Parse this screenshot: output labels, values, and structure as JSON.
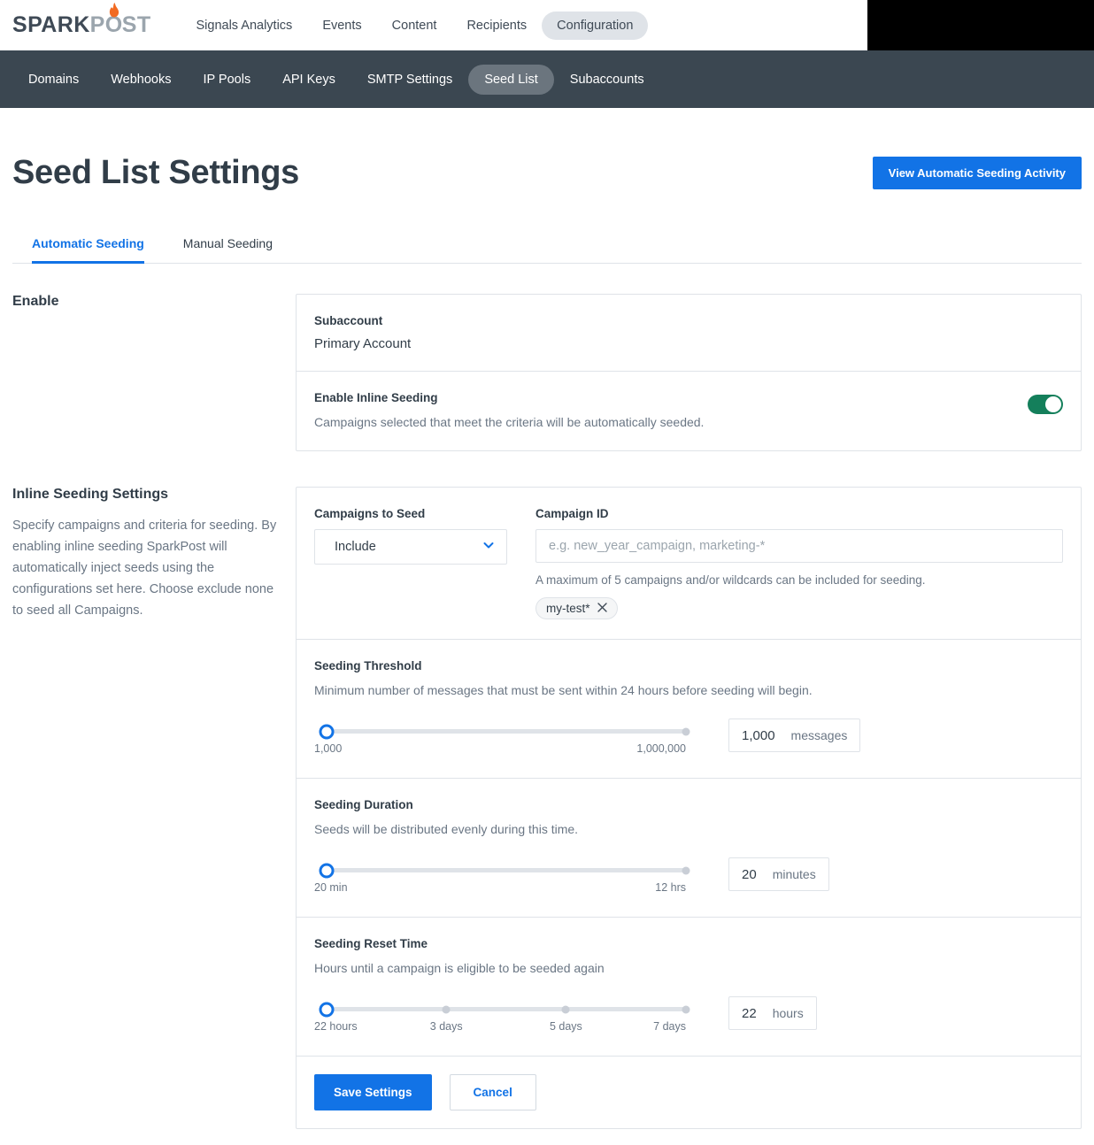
{
  "brand": {
    "logo_part1": "SPARK",
    "logo_part2": "P",
    "logo_part3": "O",
    "logo_part4": "ST",
    "accent": "#f26a21"
  },
  "mainnav": {
    "items": [
      {
        "label": "Signals Analytics",
        "active": false
      },
      {
        "label": "Events",
        "active": false
      },
      {
        "label": "Content",
        "active": false
      },
      {
        "label": "Recipients",
        "active": false
      },
      {
        "label": "Configuration",
        "active": true
      }
    ]
  },
  "subnav": {
    "items": [
      {
        "label": "Domains",
        "active": false
      },
      {
        "label": "Webhooks",
        "active": false
      },
      {
        "label": "IP Pools",
        "active": false
      },
      {
        "label": "API Keys",
        "active": false
      },
      {
        "label": "SMTP Settings",
        "active": false
      },
      {
        "label": "Seed List",
        "active": true
      },
      {
        "label": "Subaccounts",
        "active": false
      }
    ]
  },
  "header": {
    "title": "Seed List Settings",
    "activity_button": "View Automatic Seeding Activity"
  },
  "tabs": [
    {
      "label": "Automatic Seeding",
      "active": true
    },
    {
      "label": "Manual Seeding",
      "active": false
    }
  ],
  "enable_section": {
    "heading": "Enable",
    "subaccount_label": "Subaccount",
    "subaccount_value": "Primary Account",
    "inline_label": "Enable Inline Seeding",
    "inline_desc": "Campaigns selected that meet the criteria will be automatically seeded.",
    "toggle_state": "on",
    "toggle_color": "#147f5b"
  },
  "inline_section": {
    "heading": "Inline Seeding Settings",
    "description": "Specify campaigns and criteria for seeding. By enabling inline seeding SparkPost will automatically inject seeds using the configurations set here. Choose exclude none to seed all Campaigns.",
    "campaigns_to_seed_label": "Campaigns to Seed",
    "campaigns_to_seed_value": "Include",
    "campaign_id_label": "Campaign ID",
    "campaign_id_placeholder": "e.g. new_year_campaign, marketing-*",
    "campaign_id_value": "",
    "campaign_helper": "A maximum of 5 campaigns and/or wildcards can be included for seeding.",
    "chips": [
      {
        "label": "my-test*"
      }
    ]
  },
  "threshold": {
    "title": "Seeding Threshold",
    "desc": "Minimum number of messages that must be sent within 24 hours before seeding will begin.",
    "ticks": [
      {
        "label": "1,000",
        "pos": 0
      },
      {
        "label": "1,000,000",
        "pos": 100
      }
    ],
    "handle_pos": 0,
    "value": "1,000",
    "unit": "messages"
  },
  "duration": {
    "title": "Seeding Duration",
    "desc": "Seeds will be distributed evenly during this time.",
    "ticks": [
      {
        "label": "20 min",
        "pos": 0
      },
      {
        "label": "12 hrs",
        "pos": 100
      }
    ],
    "handle_pos": 0,
    "value": "20",
    "unit": "minutes"
  },
  "reset": {
    "title": "Seeding Reset Time",
    "desc": "Hours until a campaign is eligible to be seeded again",
    "ticks": [
      {
        "label": "22 hours",
        "pos": 0
      },
      {
        "label": "3 days",
        "pos": 33.3
      },
      {
        "label": "5 days",
        "pos": 66.6
      },
      {
        "label": "7 days",
        "pos": 100
      }
    ],
    "handle_pos": 0,
    "value": "22",
    "unit": "hours"
  },
  "footer": {
    "save_label": "Save Settings",
    "cancel_label": "Cancel"
  }
}
